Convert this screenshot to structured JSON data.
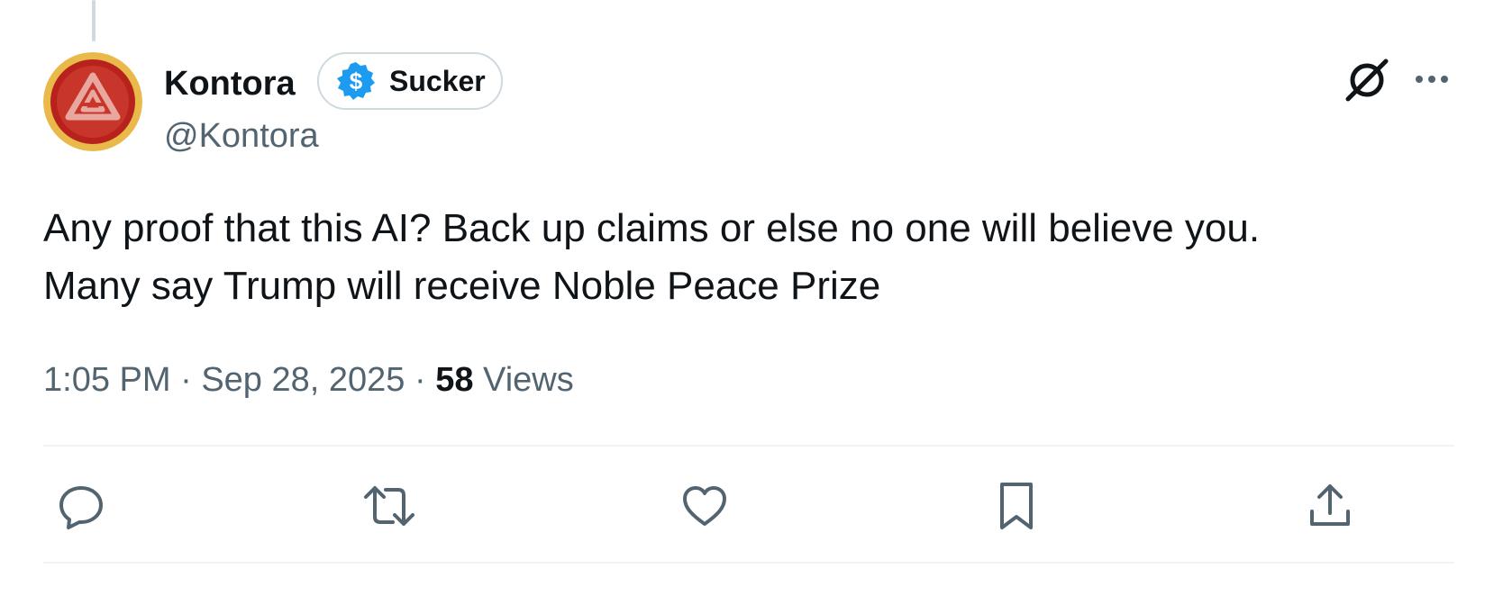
{
  "tweet": {
    "author": {
      "name": "Kontora",
      "handle": "@Kontora",
      "avatar_icon": "red-triangle-emblem-avatar"
    },
    "badge": {
      "icon": "dollar-coin-icon",
      "label": "Sucker",
      "icon_color": "#1d9bf0"
    },
    "text_lines": [
      "Any proof that this AI? Back up claims or else no one will believe you.",
      "Many say Trump will receive Noble Peace Prize"
    ],
    "meta": {
      "time": "1:05 PM",
      "separator": "·",
      "date": "Sep 28, 2025",
      "views_count": "58",
      "views_label": "Views"
    },
    "header_icons": [
      "grok-icon",
      "more-icon"
    ],
    "actions": [
      "reply-icon",
      "retweet-icon",
      "like-icon",
      "bookmark-icon",
      "share-icon"
    ]
  },
  "colors": {
    "text_primary": "#0f1419",
    "text_secondary": "#536471",
    "divider": "#eff3f4",
    "badge_border": "#cfd9de",
    "accent_blue": "#1d9bf0"
  }
}
